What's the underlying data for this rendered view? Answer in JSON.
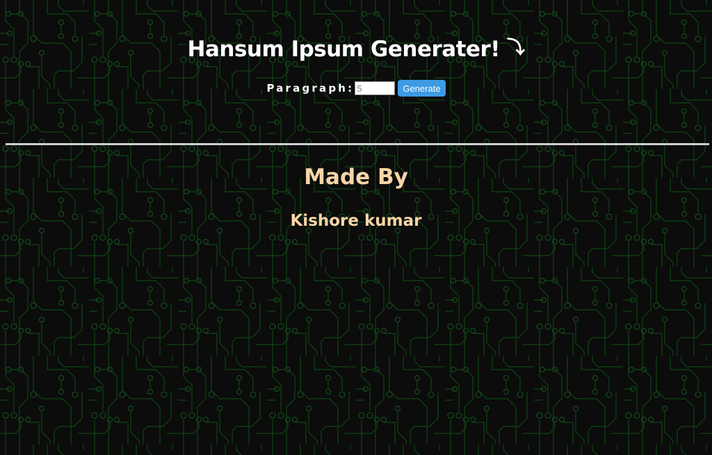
{
  "header": {
    "title": "Hansum Ipsum Generater!",
    "arrow_glyph": "⤵"
  },
  "form": {
    "paragraph_label": "Paragraph:",
    "input_placeholder": "5",
    "generate_label": "Generate"
  },
  "credits": {
    "heading": "Made By",
    "author": "Kishore kumar"
  },
  "colors": {
    "background": "#0b0c0b",
    "circuit_trace": "#0f3d12",
    "title_text": "#ffffff",
    "credit_text": "#f9d5a7",
    "button": "#3d9be3",
    "divider": "#cfcfcf"
  },
  "icons": {
    "title_arrow": "curved-arrow-down-icon"
  }
}
